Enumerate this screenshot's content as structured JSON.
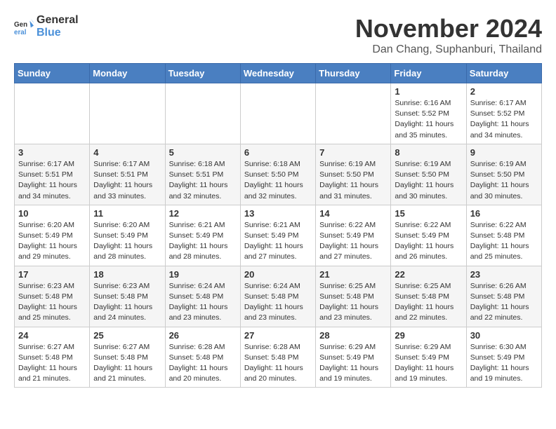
{
  "logo": {
    "general": "General",
    "blue": "Blue"
  },
  "title": "November 2024",
  "subtitle": "Dan Chang, Suphanburi, Thailand",
  "days_of_week": [
    "Sunday",
    "Monday",
    "Tuesday",
    "Wednesday",
    "Thursday",
    "Friday",
    "Saturday"
  ],
  "weeks": [
    [
      {
        "day": "",
        "info": ""
      },
      {
        "day": "",
        "info": ""
      },
      {
        "day": "",
        "info": ""
      },
      {
        "day": "",
        "info": ""
      },
      {
        "day": "",
        "info": ""
      },
      {
        "day": "1",
        "info": "Sunrise: 6:16 AM\nSunset: 5:52 PM\nDaylight: 11 hours\nand 35 minutes."
      },
      {
        "day": "2",
        "info": "Sunrise: 6:17 AM\nSunset: 5:52 PM\nDaylight: 11 hours\nand 34 minutes."
      }
    ],
    [
      {
        "day": "3",
        "info": "Sunrise: 6:17 AM\nSunset: 5:51 PM\nDaylight: 11 hours\nand 34 minutes."
      },
      {
        "day": "4",
        "info": "Sunrise: 6:17 AM\nSunset: 5:51 PM\nDaylight: 11 hours\nand 33 minutes."
      },
      {
        "day": "5",
        "info": "Sunrise: 6:18 AM\nSunset: 5:51 PM\nDaylight: 11 hours\nand 32 minutes."
      },
      {
        "day": "6",
        "info": "Sunrise: 6:18 AM\nSunset: 5:50 PM\nDaylight: 11 hours\nand 32 minutes."
      },
      {
        "day": "7",
        "info": "Sunrise: 6:19 AM\nSunset: 5:50 PM\nDaylight: 11 hours\nand 31 minutes."
      },
      {
        "day": "8",
        "info": "Sunrise: 6:19 AM\nSunset: 5:50 PM\nDaylight: 11 hours\nand 30 minutes."
      },
      {
        "day": "9",
        "info": "Sunrise: 6:19 AM\nSunset: 5:50 PM\nDaylight: 11 hours\nand 30 minutes."
      }
    ],
    [
      {
        "day": "10",
        "info": "Sunrise: 6:20 AM\nSunset: 5:49 PM\nDaylight: 11 hours\nand 29 minutes."
      },
      {
        "day": "11",
        "info": "Sunrise: 6:20 AM\nSunset: 5:49 PM\nDaylight: 11 hours\nand 28 minutes."
      },
      {
        "day": "12",
        "info": "Sunrise: 6:21 AM\nSunset: 5:49 PM\nDaylight: 11 hours\nand 28 minutes."
      },
      {
        "day": "13",
        "info": "Sunrise: 6:21 AM\nSunset: 5:49 PM\nDaylight: 11 hours\nand 27 minutes."
      },
      {
        "day": "14",
        "info": "Sunrise: 6:22 AM\nSunset: 5:49 PM\nDaylight: 11 hours\nand 27 minutes."
      },
      {
        "day": "15",
        "info": "Sunrise: 6:22 AM\nSunset: 5:49 PM\nDaylight: 11 hours\nand 26 minutes."
      },
      {
        "day": "16",
        "info": "Sunrise: 6:22 AM\nSunset: 5:48 PM\nDaylight: 11 hours\nand 25 minutes."
      }
    ],
    [
      {
        "day": "17",
        "info": "Sunrise: 6:23 AM\nSunset: 5:48 PM\nDaylight: 11 hours\nand 25 minutes."
      },
      {
        "day": "18",
        "info": "Sunrise: 6:23 AM\nSunset: 5:48 PM\nDaylight: 11 hours\nand 24 minutes."
      },
      {
        "day": "19",
        "info": "Sunrise: 6:24 AM\nSunset: 5:48 PM\nDaylight: 11 hours\nand 23 minutes."
      },
      {
        "day": "20",
        "info": "Sunrise: 6:24 AM\nSunset: 5:48 PM\nDaylight: 11 hours\nand 23 minutes."
      },
      {
        "day": "21",
        "info": "Sunrise: 6:25 AM\nSunset: 5:48 PM\nDaylight: 11 hours\nand 23 minutes."
      },
      {
        "day": "22",
        "info": "Sunrise: 6:25 AM\nSunset: 5:48 PM\nDaylight: 11 hours\nand 22 minutes."
      },
      {
        "day": "23",
        "info": "Sunrise: 6:26 AM\nSunset: 5:48 PM\nDaylight: 11 hours\nand 22 minutes."
      }
    ],
    [
      {
        "day": "24",
        "info": "Sunrise: 6:27 AM\nSunset: 5:48 PM\nDaylight: 11 hours\nand 21 minutes."
      },
      {
        "day": "25",
        "info": "Sunrise: 6:27 AM\nSunset: 5:48 PM\nDaylight: 11 hours\nand 21 minutes."
      },
      {
        "day": "26",
        "info": "Sunrise: 6:28 AM\nSunset: 5:48 PM\nDaylight: 11 hours\nand 20 minutes."
      },
      {
        "day": "27",
        "info": "Sunrise: 6:28 AM\nSunset: 5:48 PM\nDaylight: 11 hours\nand 20 minutes."
      },
      {
        "day": "28",
        "info": "Sunrise: 6:29 AM\nSunset: 5:49 PM\nDaylight: 11 hours\nand 19 minutes."
      },
      {
        "day": "29",
        "info": "Sunrise: 6:29 AM\nSunset: 5:49 PM\nDaylight: 11 hours\nand 19 minutes."
      },
      {
        "day": "30",
        "info": "Sunrise: 6:30 AM\nSunset: 5:49 PM\nDaylight: 11 hours\nand 19 minutes."
      }
    ]
  ]
}
